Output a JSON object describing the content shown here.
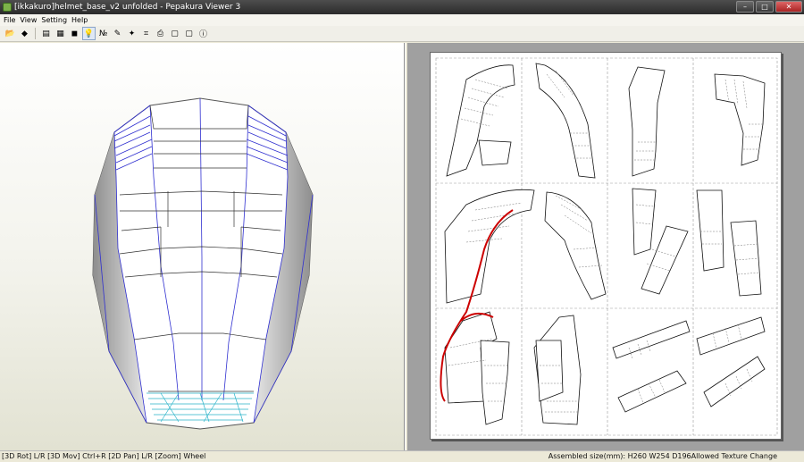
{
  "window": {
    "title": "[ikkakuro]helmet_base_v2 unfolded - Pepakura Viewer 3",
    "minimize_glyph": "–",
    "maximize_glyph": "□",
    "close_glyph": "✕"
  },
  "menu": {
    "items": [
      "File",
      "View",
      "Setting",
      "Help"
    ]
  },
  "toolbar": {
    "buttons": [
      {
        "name": "open-file-icon",
        "glyph": "📂"
      },
      {
        "name": "3d-model-icon",
        "glyph": "◆"
      },
      {
        "name": "print-preview-icon",
        "glyph": "▤"
      },
      {
        "name": "texture-icon",
        "glyph": "▦"
      },
      {
        "name": "cube-icon",
        "glyph": "◼"
      },
      {
        "name": "light-bulb-icon",
        "glyph": "💡"
      },
      {
        "name": "part-numbers-icon",
        "glyph": "№"
      },
      {
        "name": "edge-id-icon",
        "glyph": "✎"
      },
      {
        "name": "magic-wand-icon",
        "glyph": "✦"
      },
      {
        "name": "flap-icon",
        "glyph": "⌗"
      },
      {
        "name": "print-icon",
        "glyph": "⎙"
      },
      {
        "name": "window-2d-icon",
        "glyph": "▢"
      },
      {
        "name": "window-3d-icon",
        "glyph": "▢"
      },
      {
        "name": "info-icon",
        "glyph": "ⓘ"
      }
    ]
  },
  "status": {
    "left": "[3D Rot] L/R [3D Mov] Ctrl+R [2D Pan] L/R [Zoom] Wheel",
    "right": "Assembled size(mm): H260 W254 D196Allowed Texture Change"
  },
  "colors": {
    "edge_blue": "#2f2fd0",
    "cut_red": "#cc0000",
    "model_face": "#ffffff"
  }
}
